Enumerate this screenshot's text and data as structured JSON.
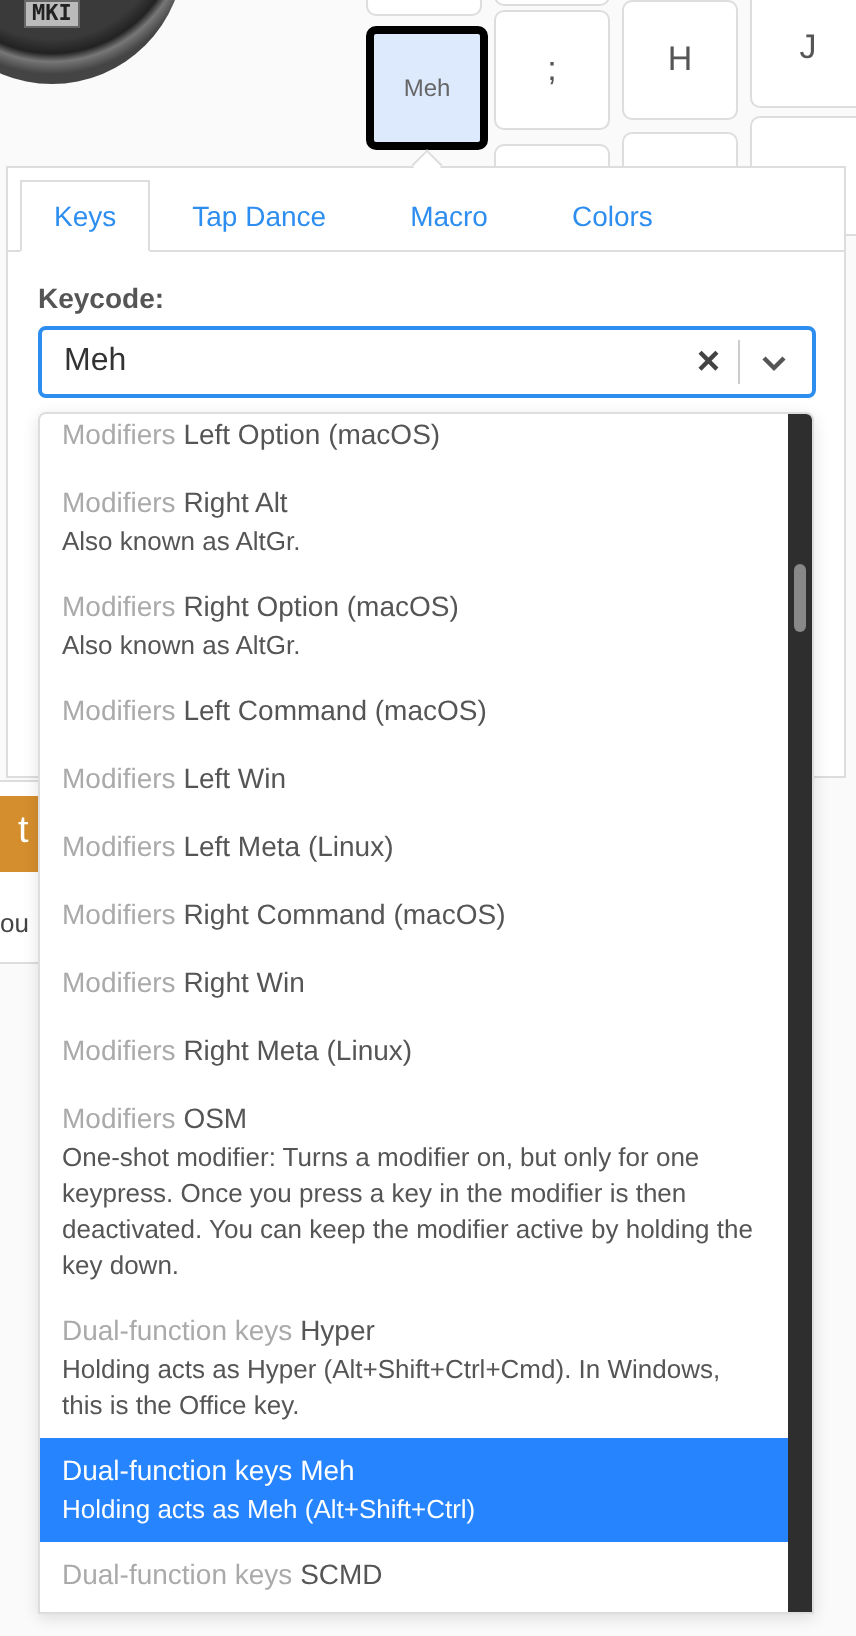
{
  "logo": {
    "label": "MKI"
  },
  "keys": [
    {
      "label": "Meh",
      "selected": true
    },
    {
      "label": ";",
      "selected": false
    },
    {
      "label": "H",
      "selected": false
    },
    {
      "label": "J",
      "selected": false
    }
  ],
  "background": {
    "button": "t",
    "text": "ou"
  },
  "popover": {
    "tabs": [
      {
        "label": "Keys",
        "selected": true
      },
      {
        "label": "Tap Dance",
        "selected": false
      },
      {
        "label": "Macro",
        "selected": false
      },
      {
        "label": "Colors",
        "selected": false
      }
    ],
    "keycode_label": "Keycode:",
    "keycode_value": "Meh",
    "clear_icon": "×",
    "options": [
      {
        "group": "Modifiers",
        "name": "Left Option (macOS)",
        "selected": false
      },
      {
        "group": "Modifiers",
        "name": "Right Alt",
        "description": "Also known as AltGr.",
        "selected": false
      },
      {
        "group": "Modifiers",
        "name": "Right Option (macOS)",
        "description": "Also known as AltGr.",
        "selected": false
      },
      {
        "group": "Modifiers",
        "name": "Left Command (macOS)",
        "selected": false
      },
      {
        "group": "Modifiers",
        "name": "Left Win",
        "selected": false
      },
      {
        "group": "Modifiers",
        "name": "Left Meta (Linux)",
        "selected": false
      },
      {
        "group": "Modifiers",
        "name": "Right Command (macOS)",
        "selected": false
      },
      {
        "group": "Modifiers",
        "name": "Right Win",
        "selected": false
      },
      {
        "group": "Modifiers",
        "name": "Right Meta (Linux)",
        "selected": false
      },
      {
        "group": "Modifiers",
        "name": "OSM",
        "description": "One-shot modifier: Turns a modifier on, but only for one keypress. Once you press a key in the modifier is then deactivated. You can keep the modifier active by holding the key down.",
        "selected": false
      },
      {
        "group": "Dual-function keys",
        "name": "Hyper",
        "description": "Holding acts as Hyper (Alt+Shift+Ctrl+Cmd). In Windows, this is the Office key.",
        "selected": false
      },
      {
        "group": "Dual-function keys",
        "name": "Meh",
        "description": "Holding acts as Meh (Alt+Shift+Ctrl)",
        "selected": true
      },
      {
        "group": "Dual-function keys",
        "name": "SCMD",
        "selected": false
      }
    ]
  }
}
